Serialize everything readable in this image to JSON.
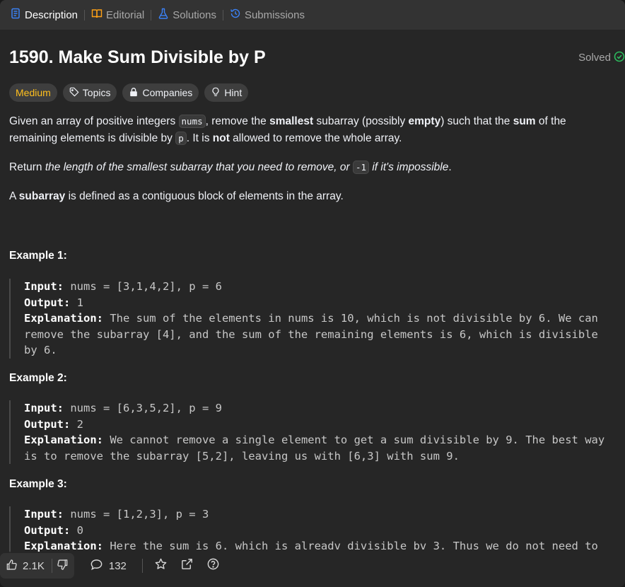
{
  "tabs": [
    {
      "label": "Description",
      "icon": "description-icon",
      "active": true
    },
    {
      "label": "Editorial",
      "icon": "book-icon",
      "active": false
    },
    {
      "label": "Solutions",
      "icon": "flask-icon",
      "active": false
    },
    {
      "label": "Submissions",
      "icon": "history-icon",
      "active": false
    }
  ],
  "problem": {
    "title": "1590. Make Sum Divisible by P",
    "status": "Solved",
    "difficulty": "Medium"
  },
  "tags": {
    "topics": "Topics",
    "companies": "Companies",
    "hint": "Hint"
  },
  "description": {
    "p1": {
      "t1": "Given an array of positive integers ",
      "c1": "nums",
      "t2": ", remove the ",
      "b1": "smallest",
      "t3": " subarray (possibly ",
      "b2": "empty",
      "t4": ") such that the ",
      "b3": "sum",
      "t5": " of the remaining elements is divisible by ",
      "c2": "p",
      "t6": ". It is ",
      "b4": "not",
      "t7": " allowed to remove the whole array."
    },
    "p2": {
      "t1": "Return ",
      "i1": "the length of the smallest subarray that you need to remove, or ",
      "c1": "-1",
      "i2": " if it's impossible",
      "t2": "."
    },
    "p3": {
      "t1": "A ",
      "b1": "subarray",
      "t2": " is defined as a contiguous block of elements in the array."
    }
  },
  "examples": [
    {
      "title": "Example 1:",
      "input_label": "Input:",
      "input": " nums = [3,1,4,2], p = 6",
      "output_label": "Output:",
      "output": " 1",
      "explanation_label": "Explanation:",
      "explanation_line1": " The sum of the elements in nums is 10, which is not divisible by 6. We can",
      "explanation_line2": "remove the subarray [4], and the sum of the remaining elements is 6, which is divisible",
      "explanation_line3": "by 6."
    },
    {
      "title": "Example 2:",
      "input_label": "Input:",
      "input": " nums = [6,3,5,2], p = 9",
      "output_label": "Output:",
      "output": " 2",
      "explanation_label": "Explanation:",
      "explanation_line1": " We cannot remove a single element to get a sum divisible by 9. The best way",
      "explanation_line2": "is to remove the subarray [5,2], leaving us with [6,3] with sum 9."
    },
    {
      "title": "Example 3:",
      "input_label": "Input:",
      "input": " nums = [1,2,3], p = 3",
      "output_label": "Output:",
      "output": " 0",
      "explanation_label": "Explanation:",
      "explanation_line1": " Here the sum is 6. which is alreadv divisible bv 3. Thus we do not need to"
    }
  ],
  "bottom": {
    "likes": "2.1K",
    "comments": "132"
  },
  "colors": {
    "medium": "#ffc01e",
    "solved": "#2cbb5d",
    "active_tab_icon": "#3b82f6"
  }
}
